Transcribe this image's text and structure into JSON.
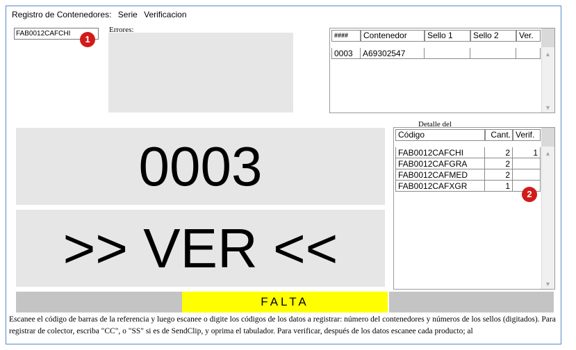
{
  "header": {
    "app": "Registro de Contenedores:",
    "menu_serie": "Serie",
    "menu_verificacion": "Verificacion"
  },
  "scan_input": {
    "value": "FAB0012CAFCHI"
  },
  "badges": {
    "one": "1",
    "two": "2"
  },
  "errors": {
    "label": "Errores:"
  },
  "containers_table": {
    "columns": [
      "####",
      "Contenedor",
      "Sello 1",
      "Sello 2",
      "Ver."
    ],
    "rows": [
      {
        "num": "0003",
        "container": "A69302547",
        "seal1": "",
        "seal2": "",
        "ver": ""
      }
    ]
  },
  "detail": {
    "title": "Detalle del",
    "columns": [
      "Código",
      "Cant.",
      "Verif."
    ],
    "rows": [
      {
        "code": "FAB0012CAFCHI",
        "qty": "2",
        "verif": "1"
      },
      {
        "code": "FAB0012CAFGRA",
        "qty": "2",
        "verif": ""
      },
      {
        "code": "FAB0012CAFMED",
        "qty": "2",
        "verif": ""
      },
      {
        "code": "FAB0012CAFXGR",
        "qty": "1",
        "verif": ""
      }
    ]
  },
  "big_number": "0003",
  "big_status": ">> VER <<",
  "status_text": "FALTA",
  "instructions": "Escanee el código de barras de la referencia y luego escanee o digite los códigos de los datos a registrar: número del contenedores y números de los sellos (digitados). Para registrar de colector, escriba \"CC\", o \"SS\" si es de SendClip, y oprima el tabulador. Para verificar, después de los datos escanee cada producto; al",
  "icons": {
    "scroll_up": "scroll-up-arrow",
    "scroll_down": "scroll-down-arrow"
  },
  "colors": {
    "frame_border": "#5a87c6",
    "badge": "#d21a1a",
    "status_bg": "#ffff00",
    "panel_bg": "#e6e6e6"
  }
}
